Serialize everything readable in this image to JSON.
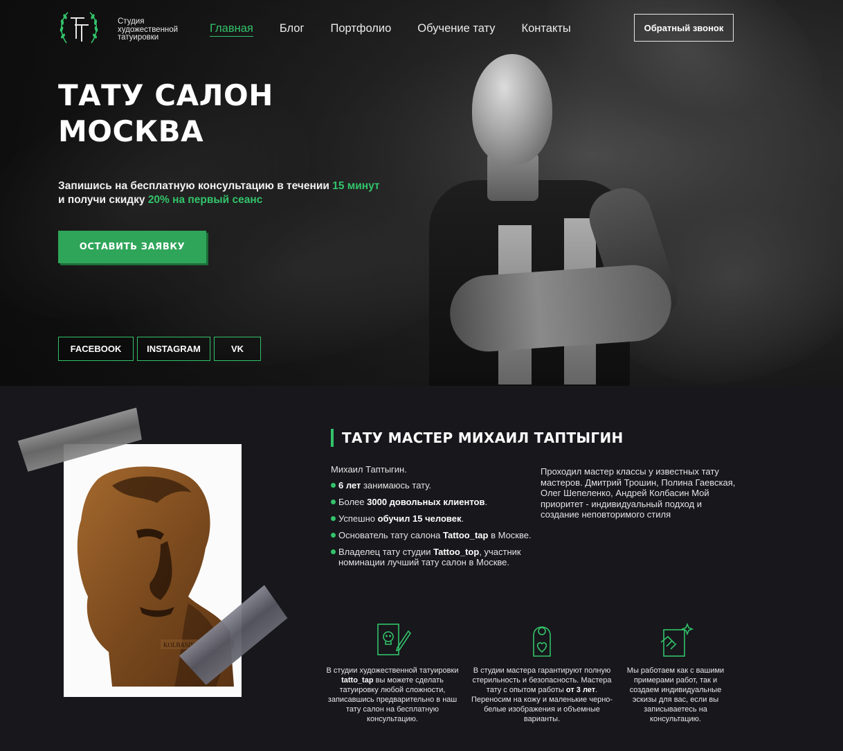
{
  "colors": {
    "accent": "#33c36a",
    "button": "#2fa55a",
    "background": "#17171c"
  },
  "header": {
    "logo_icon": "tt-monogram-laurel-icon",
    "logo_lines": [
      "Студия",
      "художественной",
      "татуировки"
    ],
    "nav": [
      {
        "label": "Главная",
        "active": true
      },
      {
        "label": "Блог"
      },
      {
        "label": "Портфолио"
      },
      {
        "label": "Обучение тату"
      },
      {
        "label": "Контакты"
      }
    ],
    "callback_label": "Обратный звонок"
  },
  "hero": {
    "title_line1": "ТАТУ САЛОН",
    "title_line2": "МОСКВА",
    "sub_part1": "Запишись на бесплатную консультацию в течении ",
    "sub_green1": "15 минут",
    "sub_part2": "и получи скидку ",
    "sub_green2": "20% на первый сеанс",
    "cta_label": "ОСТАВИТЬ ЗАЯВКУ",
    "socials": [
      "FACEBOOK",
      "INSTAGRAM",
      "VK"
    ]
  },
  "about": {
    "title": "ТАТУ МАСТЕР МИХАИЛ ТАПТЫГИН",
    "intro": "Михаил Таптыгин.",
    "bullets": [
      {
        "bold": "6 лет",
        "text": " занимаюсь тату."
      },
      {
        "pre": "Более ",
        "bold": "3000 довольных клиентов",
        "text": "."
      },
      {
        "pre": "Успешно ",
        "bold": "обучил 15 человек",
        "text": "."
      },
      {
        "pre": "Основатель тату салона ",
        "bold": "Tattoo_tap",
        "text": " в Москве."
      },
      {
        "pre": "Владелец тату студии ",
        "bold": "Tattoo_top",
        "text": ", участник номинации лучший тату салон в Москве."
      }
    ],
    "right_text": "Проходил мастер классы у известных тату мастеров. Дмитрий Трошин, Полина Гаевская, Олег Шепеленко, Андрей Колбасин Мой приоритет - индивидуальный подход и создание неповторимого стиля",
    "plaque_text": "KOLBASIN TATTOO SCHO",
    "features": [
      {
        "icon": "skull-document-pen-icon",
        "p1": "В студии художественной татуировки ",
        "b1": "tatto_tap",
        "p2": " вы можете сделать татуировку любой сложности, записавшись предварительно в наш тату салон на бесплатную консультацию."
      },
      {
        "icon": "door-hanger-heart-icon",
        "p1": "В студии мастера гарантируют полную стерильность и безопасность. Мастера тату с опытом работы ",
        "b1": "от 3 лет",
        "p2": ". Переносим на кожу и маленькие черно-белые изображения и объемные варианты."
      },
      {
        "icon": "hand-sketch-sparkle-icon",
        "p1": "Мы работаем как с вашими примерами работ, так и создаем индивидуальные эскизы для вас, если вы записываетесь на консультацию.",
        "b1": "",
        "p2": ""
      }
    ]
  }
}
